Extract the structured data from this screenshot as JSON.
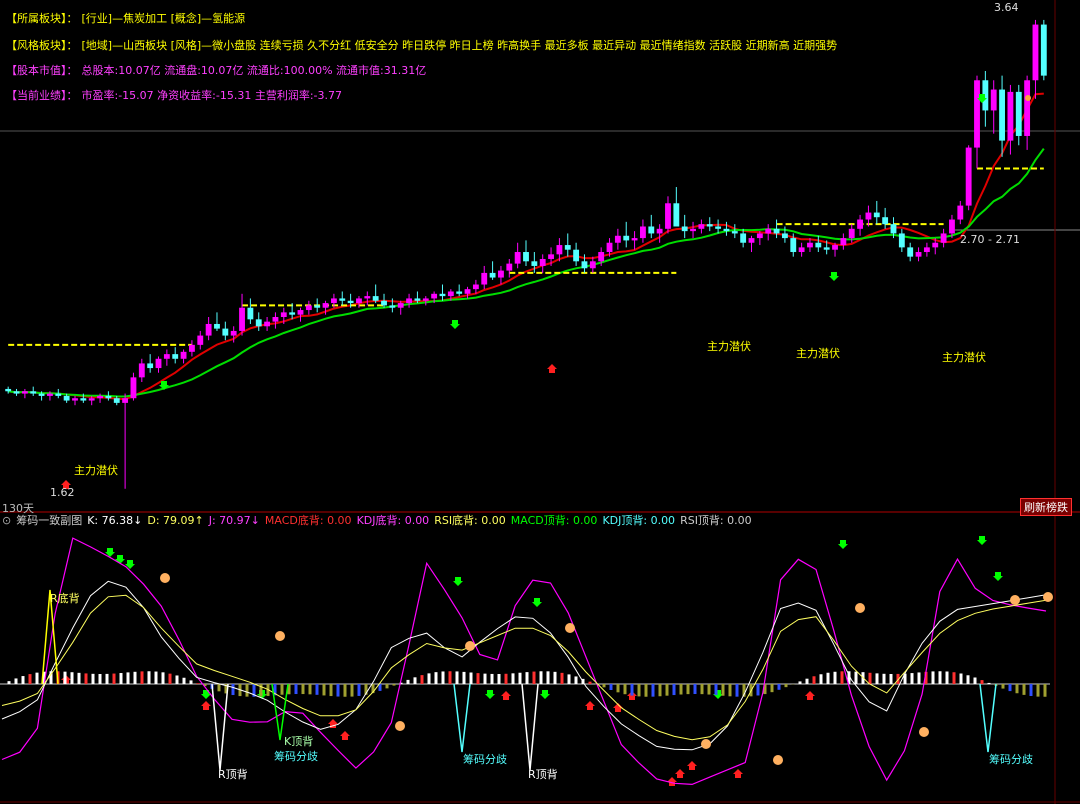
{
  "info": {
    "sector": {
      "label": "【所属板块】：",
      "text": "[行业]—焦炭加工 [概念]—氢能源"
    },
    "style": {
      "label": "【风格板块】：",
      "text": "[地域]—山西板块 [风格]—微小盘股 连续亏损 久不分红 低安全分 昨日跌停 昨日上榜 昨高换手 最近多板 最近异动 最近情绪指数 活跃股 近期新高 近期强势"
    },
    "capital": {
      "label": "【股本市值】：",
      "text": "总股本:10.07亿 流通盘:10.07亿 流通比:100.00% 流通市值:31.31亿"
    },
    "perf": {
      "label": "【当前业绩】：",
      "text": "市盈率:-15.07 净资收益率:-15.31 主营利润率:-3.77"
    }
  },
  "price_labels": {
    "high": "3.64",
    "low": "1.62",
    "range": "2.70 - 2.71",
    "days": "130天"
  },
  "annotations": {
    "main_force": "主力潜伏"
  },
  "badge": "刷新榜跌",
  "indicator_bar": {
    "name": "筹码一致副图",
    "k": "K: 76.38↓",
    "d": "D: 79.09↑",
    "j": "J: 70.97↓",
    "macd_bottom": "MACD底背: 0.00",
    "kdj_bottom": "KDJ底背: 0.00",
    "rsi_bottom": "RSI底背: 0.00",
    "macd_top": "MACD顶背: 0.00",
    "kdj_top": "KDJ顶背: 0.00",
    "rsi_top": "RSI顶背: 0.00"
  },
  "sub_labels": {
    "r_bottom": "R底背",
    "r_top": "R顶背",
    "chip_div": "筹码分歧",
    "k_top": "K顶背"
  },
  "colors": {
    "up": "#ff00ff",
    "down": "#54ffff",
    "ma_fast": "#e00000",
    "ma_slow": "#00dd00",
    "support": "#ffff00",
    "kline": "#ff00ff",
    "dline": "#ffff60"
  },
  "candles": [
    [
      2.05,
      2.06,
      2.03,
      2.04
    ],
    [
      2.04,
      2.05,
      2.02,
      2.03
    ],
    [
      2.03,
      2.05,
      2.01,
      2.04
    ],
    [
      2.04,
      2.06,
      2.02,
      2.03
    ],
    [
      2.03,
      2.04,
      2.0,
      2.02
    ],
    [
      2.02,
      2.04,
      2.0,
      2.03
    ],
    [
      2.03,
      2.05,
      2.01,
      2.02
    ],
    [
      2.02,
      2.03,
      1.99,
      2.0
    ],
    [
      2.0,
      2.02,
      1.98,
      2.01
    ],
    [
      2.01,
      2.03,
      1.99,
      2.0
    ],
    [
      2.0,
      2.02,
      1.98,
      2.01
    ],
    [
      2.01,
      2.03,
      1.99,
      2.02
    ],
    [
      2.02,
      2.04,
      2.0,
      2.01
    ],
    [
      2.01,
      2.02,
      1.98,
      1.99
    ],
    [
      1.99,
      2.03,
      1.62,
      2.01
    ],
    [
      2.01,
      2.12,
      2.0,
      2.1
    ],
    [
      2.1,
      2.18,
      2.08,
      2.16
    ],
    [
      2.16,
      2.2,
      2.12,
      2.14
    ],
    [
      2.14,
      2.19,
      2.12,
      2.18
    ],
    [
      2.18,
      2.22,
      2.15,
      2.2
    ],
    [
      2.2,
      2.23,
      2.16,
      2.18
    ],
    [
      2.18,
      2.22,
      2.16,
      2.21
    ],
    [
      2.21,
      2.26,
      2.19,
      2.24
    ],
    [
      2.24,
      2.3,
      2.22,
      2.28
    ],
    [
      2.28,
      2.36,
      2.26,
      2.33
    ],
    [
      2.33,
      2.38,
      2.3,
      2.31
    ],
    [
      2.31,
      2.34,
      2.26,
      2.28
    ],
    [
      2.28,
      2.32,
      2.25,
      2.3
    ],
    [
      2.3,
      2.46,
      2.28,
      2.4
    ],
    [
      2.4,
      2.44,
      2.33,
      2.35
    ],
    [
      2.35,
      2.38,
      2.3,
      2.32
    ],
    [
      2.32,
      2.36,
      2.3,
      2.34
    ],
    [
      2.34,
      2.38,
      2.31,
      2.36
    ],
    [
      2.36,
      2.4,
      2.33,
      2.38
    ],
    [
      2.38,
      2.42,
      2.35,
      2.37
    ],
    [
      2.37,
      2.4,
      2.34,
      2.39
    ],
    [
      2.39,
      2.43,
      2.37,
      2.41
    ],
    [
      2.41,
      2.44,
      2.38,
      2.4
    ],
    [
      2.4,
      2.43,
      2.37,
      2.42
    ],
    [
      2.42,
      2.46,
      2.4,
      2.44
    ],
    [
      2.44,
      2.47,
      2.41,
      2.43
    ],
    [
      2.43,
      2.46,
      2.4,
      2.42
    ],
    [
      2.42,
      2.45,
      2.4,
      2.44
    ],
    [
      2.44,
      2.47,
      2.41,
      2.45
    ],
    [
      2.45,
      2.5,
      2.42,
      2.43
    ],
    [
      2.43,
      2.46,
      2.4,
      2.41
    ],
    [
      2.41,
      2.44,
      2.38,
      2.4
    ],
    [
      2.4,
      2.43,
      2.37,
      2.42
    ],
    [
      2.42,
      2.46,
      2.4,
      2.44
    ],
    [
      2.44,
      2.47,
      2.42,
      2.43
    ],
    [
      2.43,
      2.45,
      2.41,
      2.44
    ],
    [
      2.44,
      2.47,
      2.42,
      2.46
    ],
    [
      2.46,
      2.5,
      2.43,
      2.45
    ],
    [
      2.45,
      2.48,
      2.43,
      2.47
    ],
    [
      2.47,
      2.5,
      2.45,
      2.46
    ],
    [
      2.46,
      2.49,
      2.44,
      2.48
    ],
    [
      2.48,
      2.52,
      2.46,
      2.5
    ],
    [
      2.5,
      2.58,
      2.48,
      2.55
    ],
    [
      2.55,
      2.6,
      2.52,
      2.53
    ],
    [
      2.53,
      2.58,
      2.5,
      2.56
    ],
    [
      2.56,
      2.61,
      2.53,
      2.59
    ],
    [
      2.59,
      2.68,
      2.57,
      2.64
    ],
    [
      2.64,
      2.69,
      2.58,
      2.6
    ],
    [
      2.6,
      2.64,
      2.55,
      2.58
    ],
    [
      2.58,
      2.63,
      2.55,
      2.61
    ],
    [
      2.61,
      2.66,
      2.58,
      2.63
    ],
    [
      2.63,
      2.7,
      2.6,
      2.67
    ],
    [
      2.67,
      2.72,
      2.62,
      2.65
    ],
    [
      2.65,
      2.68,
      2.58,
      2.6
    ],
    [
      2.6,
      2.63,
      2.55,
      2.57
    ],
    [
      2.57,
      2.62,
      2.55,
      2.6
    ],
    [
      2.6,
      2.66,
      2.58,
      2.64
    ],
    [
      2.64,
      2.7,
      2.62,
      2.68
    ],
    [
      2.68,
      2.74,
      2.65,
      2.71
    ],
    [
      2.71,
      2.77,
      2.66,
      2.69
    ],
    [
      2.69,
      2.73,
      2.65,
      2.7
    ],
    [
      2.7,
      2.78,
      2.68,
      2.75
    ],
    [
      2.75,
      2.8,
      2.7,
      2.72
    ],
    [
      2.72,
      2.76,
      2.68,
      2.74
    ],
    [
      2.74,
      2.88,
      2.72,
      2.85
    ],
    [
      2.85,
      2.92,
      2.8,
      2.75
    ],
    [
      2.75,
      2.8,
      2.7,
      2.73
    ],
    [
      2.73,
      2.77,
      2.7,
      2.74
    ],
    [
      2.74,
      2.78,
      2.72,
      2.76
    ],
    [
      2.76,
      2.79,
      2.73,
      2.75
    ],
    [
      2.75,
      2.78,
      2.72,
      2.74
    ],
    [
      2.74,
      2.77,
      2.71,
      2.73
    ],
    [
      2.73,
      2.76,
      2.7,
      2.72
    ],
    [
      2.72,
      2.74,
      2.66,
      2.68
    ],
    [
      2.68,
      2.71,
      2.64,
      2.7
    ],
    [
      2.7,
      2.73,
      2.67,
      2.72
    ],
    [
      2.72,
      2.76,
      2.69,
      2.74
    ],
    [
      2.74,
      2.78,
      2.7,
      2.72
    ],
    [
      2.72,
      2.75,
      2.68,
      2.7
    ],
    [
      2.7,
      2.72,
      2.62,
      2.64
    ],
    [
      2.64,
      2.68,
      2.62,
      2.66
    ],
    [
      2.66,
      2.7,
      2.64,
      2.68
    ],
    [
      2.68,
      2.71,
      2.64,
      2.66
    ],
    [
      2.66,
      2.69,
      2.63,
      2.65
    ],
    [
      2.65,
      2.68,
      2.62,
      2.67
    ],
    [
      2.67,
      2.72,
      2.65,
      2.7
    ],
    [
      2.7,
      2.76,
      2.68,
      2.74
    ],
    [
      2.74,
      2.8,
      2.71,
      2.78
    ],
    [
      2.78,
      2.84,
      2.75,
      2.81
    ],
    [
      2.81,
      2.86,
      2.76,
      2.79
    ],
    [
      2.79,
      2.83,
      2.74,
      2.76
    ],
    [
      2.76,
      2.79,
      2.7,
      2.72
    ],
    [
      2.72,
      2.74,
      2.64,
      2.66
    ],
    [
      2.66,
      2.68,
      2.6,
      2.62
    ],
    [
      2.62,
      2.66,
      2.6,
      2.64
    ],
    [
      2.64,
      2.68,
      2.62,
      2.66
    ],
    [
      2.66,
      2.7,
      2.63,
      2.68
    ],
    [
      2.68,
      2.74,
      2.66,
      2.72
    ],
    [
      2.72,
      2.8,
      2.7,
      2.78
    ],
    [
      2.78,
      2.86,
      2.76,
      2.84
    ],
    [
      2.84,
      3.1,
      2.82,
      3.09
    ],
    [
      3.09,
      3.4,
      3.0,
      3.38
    ],
    [
      3.38,
      3.42,
      3.18,
      3.25
    ],
    [
      3.25,
      3.38,
      3.15,
      3.34
    ],
    [
      3.34,
      3.4,
      3.05,
      3.12
    ],
    [
      3.12,
      3.36,
      3.06,
      3.33
    ],
    [
      3.33,
      3.36,
      3.1,
      3.14
    ],
    [
      3.14,
      3.4,
      3.08,
      3.38
    ],
    [
      3.38,
      3.64,
      3.3,
      3.62
    ],
    [
      3.62,
      3.64,
      3.38,
      3.4
    ]
  ]
}
